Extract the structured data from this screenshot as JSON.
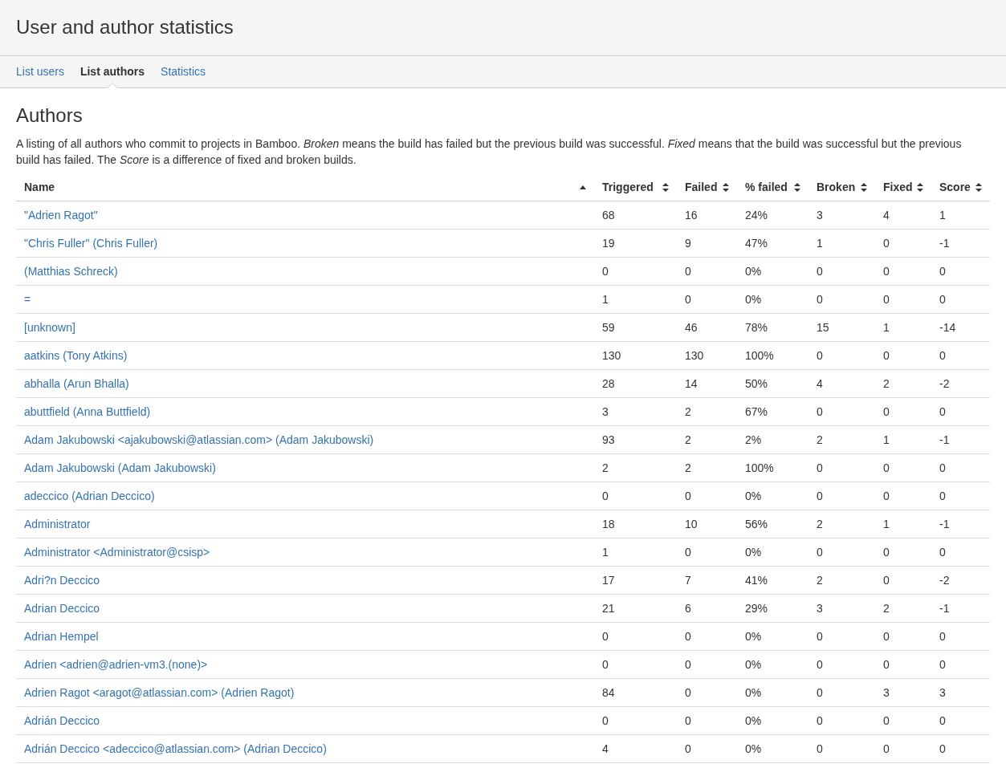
{
  "page": {
    "title": "User and author statistics"
  },
  "tabs": [
    {
      "label": "List users",
      "selected": false
    },
    {
      "label": "List authors",
      "selected": true
    },
    {
      "label": "Statistics",
      "selected": false
    }
  ],
  "section": {
    "heading": "Authors",
    "description": "A listing of all authors who commit to projects in Bamboo. *Broken* means the build has failed but the previous build was successful. *Fixed* means that the build was successful but the previous build has failed. The *Score* is a difference of fixed and broken builds."
  },
  "table": {
    "columns": [
      {
        "label": "Name",
        "sorted": true
      },
      {
        "label": "Triggered",
        "sorted": false
      },
      {
        "label": "Failed",
        "sorted": false
      },
      {
        "label": "% failed",
        "sorted": false
      },
      {
        "label": "Broken",
        "sorted": false
      },
      {
        "label": "Fixed",
        "sorted": false
      },
      {
        "label": "Score",
        "sorted": false
      }
    ],
    "rows": [
      [
        "\"Adrien Ragot\"",
        "68",
        "16",
        "24%",
        "3",
        "4",
        "1"
      ],
      [
        "\"Chris Fuller\" (Chris Fuller)",
        "19",
        "9",
        "47%",
        "1",
        "0",
        "-1"
      ],
      [
        "(Matthias Schreck)",
        "0",
        "0",
        "0%",
        "0",
        "0",
        "0"
      ],
      [
        "=",
        "1",
        "0",
        "0%",
        "0",
        "0",
        "0"
      ],
      [
        "[unknown]",
        "59",
        "46",
        "78%",
        "15",
        "1",
        "-14"
      ],
      [
        "aatkins (Tony Atkins)",
        "130",
        "130",
        "100%",
        "0",
        "0",
        "0"
      ],
      [
        "abhalla (Arun Bhalla)",
        "28",
        "14",
        "50%",
        "4",
        "2",
        "-2"
      ],
      [
        "abuttfield (Anna Buttfield)",
        "3",
        "2",
        "67%",
        "0",
        "0",
        "0"
      ],
      [
        "Adam Jakubowski <ajakubowski@atlassian.com> (Adam Jakubowski)",
        "93",
        "2",
        "2%",
        "2",
        "1",
        "-1"
      ],
      [
        "Adam Jakubowski (Adam Jakubowski)",
        "2",
        "2",
        "100%",
        "0",
        "0",
        "0"
      ],
      [
        "adeccico (Adrian Deccico)",
        "0",
        "0",
        "0%",
        "0",
        "0",
        "0"
      ],
      [
        "Administrator",
        "18",
        "10",
        "56%",
        "2",
        "1",
        "-1"
      ],
      [
        "Administrator <Administrator@csisp>",
        "1",
        "0",
        "0%",
        "0",
        "0",
        "0"
      ],
      [
        "Adri?n Deccico",
        "17",
        "7",
        "41%",
        "2",
        "0",
        "-2"
      ],
      [
        "Adrian Deccico",
        "21",
        "6",
        "29%",
        "3",
        "2",
        "-1"
      ],
      [
        "Adrian Hempel",
        "0",
        "0",
        "0%",
        "0",
        "0",
        "0"
      ],
      [
        "Adrien <adrien@adrien-vm3.(none)>",
        "0",
        "0",
        "0%",
        "0",
        "0",
        "0"
      ],
      [
        "Adrien Ragot <aragot@atlassian.com> (Adrien Ragot)",
        "84",
        "0",
        "0%",
        "0",
        "3",
        "3"
      ],
      [
        "Adrián Deccico",
        "0",
        "0",
        "0%",
        "0",
        "0",
        "0"
      ],
      [
        "Adrián Deccico <adeccico@atlassian.com> (Adrian Deccico)",
        "4",
        "0",
        "0%",
        "0",
        "0",
        "0"
      ]
    ]
  }
}
